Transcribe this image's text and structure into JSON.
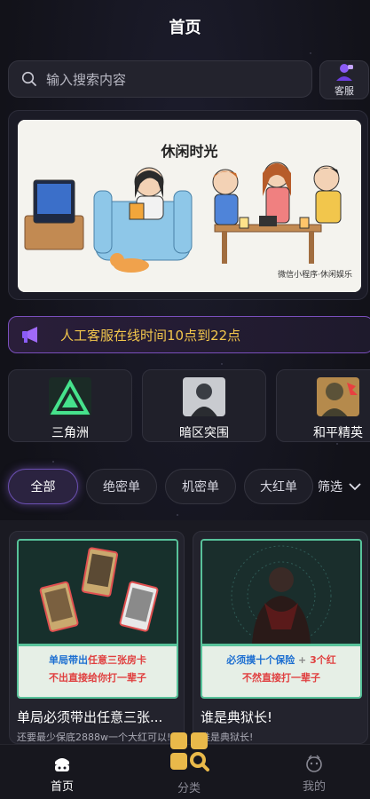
{
  "header": {
    "title": "首页"
  },
  "search": {
    "placeholder": "输入搜索内容",
    "icon": "search-icon"
  },
  "service": {
    "label": "客服",
    "icon": "customer-service-icon"
  },
  "banner": {
    "title": "休闲时光",
    "footer": "微信小程序·休闲娱乐"
  },
  "notice": {
    "text": "人工客服在线时间10点到22点",
    "icon": "megaphone-icon"
  },
  "games": [
    {
      "name": "三角洲"
    },
    {
      "name": "暗区突围"
    },
    {
      "name": "和平精英"
    }
  ],
  "filters": {
    "chips": [
      "全部",
      "绝密单",
      "机密单",
      "大红单"
    ],
    "active": "全部",
    "more_label": "筛选"
  },
  "products": [
    {
      "name": "单局必须带出任意三张...",
      "subtitle": "还要最少保底2888w一个大红可以!",
      "banner_line1_a": "单局带出",
      "banner_line1_b": "任意三张房卡",
      "banner_line2": "不出直接给你打一辈子"
    },
    {
      "name": "谁是典狱长!",
      "subtitle": "谁是典狱长!",
      "banner_line1_a": "必须摸十个保险",
      "banner_line1_b": "3个红",
      "banner_line2": "不然直接打一辈子"
    }
  ],
  "tabbar": [
    {
      "label": "首页",
      "active": true
    },
    {
      "label": "分类",
      "active": false
    },
    {
      "label": "我的",
      "active": false
    }
  ],
  "colors": {
    "accent_purple": "#7a4fbd",
    "notice_text": "#f2c64c",
    "card_border_green": "#58c29a"
  }
}
